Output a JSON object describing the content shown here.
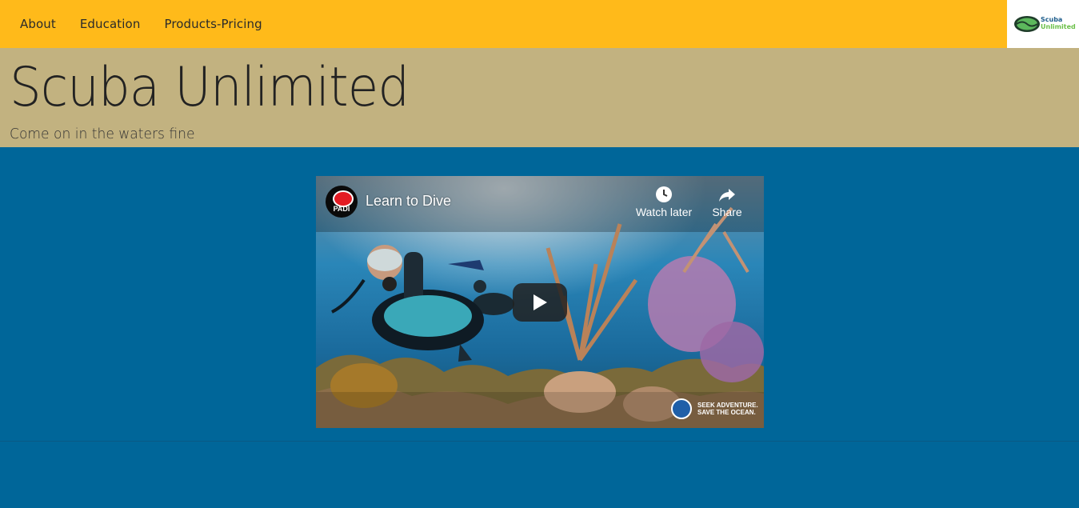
{
  "nav": {
    "links": [
      "About",
      "Education",
      "Products-Pricing"
    ],
    "logo": {
      "line1": "Scuba",
      "line2": "Unlimited"
    }
  },
  "hero": {
    "title": "Scuba Unlimited",
    "subtitle": "Come on in the waters fine"
  },
  "video": {
    "title": "Learn to Dive",
    "channel": "PADI",
    "watch_later": "Watch later",
    "share": "Share",
    "badge_line1": "SEEK ADVENTURE.",
    "badge_line2": "SAVE THE OCEAN."
  },
  "colors": {
    "navbar": "#ffba1a",
    "hero": "#c2b280",
    "page_bg": "#006699"
  }
}
